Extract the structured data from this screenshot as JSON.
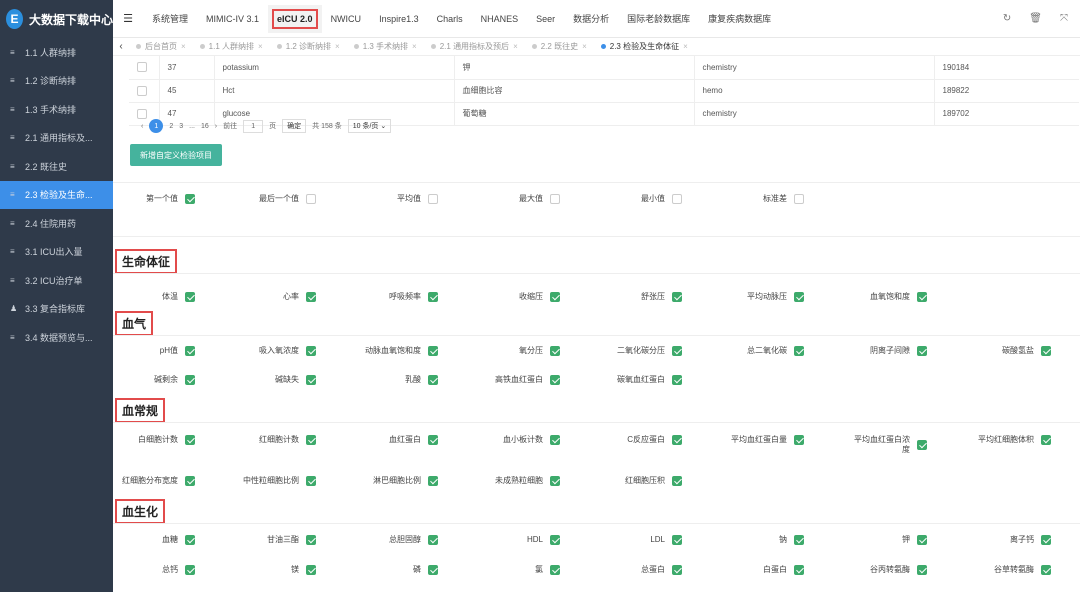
{
  "sidebar": {
    "title": "大数据下载中心",
    "items": [
      {
        "label": "1.1 人群纳排"
      },
      {
        "label": "1.2 诊断纳排"
      },
      {
        "label": "1.3 手术纳排"
      },
      {
        "label": "2.1 通用指标及..."
      },
      {
        "label": "2.2 既往史"
      },
      {
        "label": "2.3 检验及生命..."
      },
      {
        "label": "2.4 住院用药"
      },
      {
        "label": "3.1 ICU出入量"
      },
      {
        "label": "3.2 ICU治疗单"
      },
      {
        "label": "3.3 复合指标库"
      },
      {
        "label": "3.4 数据预览与..."
      }
    ]
  },
  "topnav": [
    "系统管理",
    "MIMIC-IV 3.1",
    "eICU 2.0",
    "NWICU",
    "Inspire1.3",
    "Charls",
    "NHANES",
    "Seer",
    "数据分析",
    "国际老龄数据库",
    "康复疾病数据库"
  ],
  "tabs": [
    "后台首页",
    "1.1 人群纳排",
    "1.2 诊断纳排",
    "1.3 手术纳排",
    "2.1 通用指标及预后",
    "2.2 既往史",
    "2.3 检验及生命体征"
  ],
  "table": {
    "rows": [
      {
        "id": "37",
        "name": "potassium",
        "cn": "钾",
        "cat": "chemistry",
        "code": "190184"
      },
      {
        "id": "45",
        "name": "Hct",
        "cn": "血细胞比容",
        "cat": "hemo",
        "code": "189822"
      },
      {
        "id": "47",
        "name": "glucose",
        "cn": "葡萄糖",
        "cat": "chemistry",
        "code": "189702"
      }
    ]
  },
  "pager": {
    "p1": "1",
    "p2": "2",
    "p3": "3",
    "ellipsis": "...",
    "last": "16",
    "goto": "前往",
    "page_input": "1",
    "page_unit": "页",
    "confirm": "确定",
    "total": "共 158 条",
    "size": "10 条/页"
  },
  "add_button": "新增自定义检验项目",
  "stats": [
    "第一个值",
    "最后一个值",
    "平均值",
    "最大值",
    "最小值",
    "标准差"
  ],
  "sections": {
    "vital": {
      "title": "生命体征",
      "items": [
        "体温",
        "心率",
        "呼吸频率",
        "收缩压",
        "舒张压",
        "平均动脉压",
        "血氧饱和度"
      ]
    },
    "gas": {
      "title": "血气",
      "items": [
        "pH值",
        "吸入氧浓度",
        "动脉血氧饱和度",
        "氧分压",
        "二氧化碳分压",
        "总二氧化碳",
        "阴离子间隙",
        "碳酸氢盐",
        "碱剩余",
        "碱缺失",
        "乳酸",
        "高铁血红蛋白",
        "碳氧血红蛋白"
      ]
    },
    "blood": {
      "title": "血常规",
      "items": [
        "白细胞计数",
        "红细胞计数",
        "血红蛋白",
        "血小板计数",
        "C反应蛋白",
        "平均血红蛋白量",
        "平均血红蛋白浓度",
        "平均红细胞体积",
        "红细胞分布宽度",
        "中性粒细胞比例",
        "淋巴细胞比例",
        "未成熟粒细胞",
        "红细胞压积"
      ]
    },
    "bio": {
      "title": "血生化",
      "items": [
        "血糖",
        "甘油三酯",
        "总胆固醇",
        "HDL",
        "LDL",
        "钠",
        "钾",
        "离子钙",
        "总钙",
        "镁",
        "磷",
        "氯",
        "总蛋白",
        "白蛋白",
        "谷丙转氨酶",
        "谷草转氨酶"
      ]
    }
  }
}
